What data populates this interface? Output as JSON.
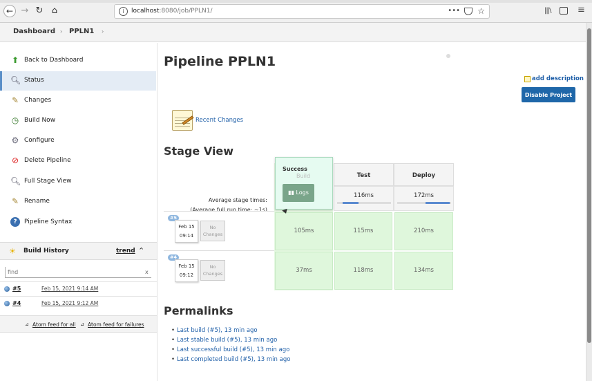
{
  "browser": {
    "url_host": "localhost",
    "url_rest": ":8080/job/PPLN1/",
    "menu_dots": "•••"
  },
  "breadcrumb": {
    "items": [
      "Dashboard",
      "PPLN1"
    ],
    "sep": "›"
  },
  "sidebar": {
    "tasks": [
      {
        "label": "Back to Dashboard",
        "icon": "up-arrow-icon"
      },
      {
        "label": "Status",
        "icon": "magnifier-icon"
      },
      {
        "label": "Changes",
        "icon": "notepad-icon"
      },
      {
        "label": "Build Now",
        "icon": "clock-play-icon"
      },
      {
        "label": "Configure",
        "icon": "gear-icon"
      },
      {
        "label": "Delete Pipeline",
        "icon": "no-entry-icon"
      },
      {
        "label": "Full Stage View",
        "icon": "magnifier-icon"
      },
      {
        "label": "Rename",
        "icon": "notepad-icon"
      },
      {
        "label": "Pipeline Syntax",
        "icon": "help-icon"
      }
    ],
    "build_history": {
      "title": "Build History",
      "trend": "trend",
      "find_placeholder": "find",
      "find_clear": "x",
      "builds": [
        {
          "num": "#5",
          "date": "Feb 15, 2021 9:14 AM"
        },
        {
          "num": "#4",
          "date": "Feb 15, 2021 9:12 AM"
        }
      ],
      "feed_all": "Atom feed for all",
      "feed_failures": "Atom feed for failures"
    }
  },
  "main": {
    "title": "Pipeline PPLN1",
    "add_description": "add description",
    "disable_button": "Disable Project",
    "recent_changes": "Recent Changes",
    "stage_view_title": "Stage View",
    "avg_label_line1": "Average stage times:",
    "avg_label_line2_pre": "(Average ",
    "avg_label_line2_u": "full",
    "avg_label_line2_post": " run time: ~1s)",
    "stages": [
      "Build",
      "Test",
      "Deploy"
    ],
    "stage_avg": [
      "",
      "116ms",
      "172ms"
    ],
    "stage_avg_fraction": [
      0.3,
      0.3,
      0.45
    ],
    "runs": [
      {
        "badge": "#5",
        "date": "Feb 15",
        "time": "09:14",
        "no_changes": [
          "No",
          "Changes"
        ],
        "times": [
          "105ms",
          "115ms",
          "210ms"
        ]
      },
      {
        "badge": "#4",
        "date": "Feb 15",
        "time": "09:12",
        "no_changes": [
          "No",
          "Changes"
        ],
        "times": [
          "37ms",
          "118ms",
          "134ms"
        ]
      }
    ],
    "popup": {
      "title": "Success",
      "sub": "Build",
      "logs": "Logs"
    },
    "permalinks_title": "Permalinks",
    "permalinks": [
      "Last build (#5), 13 min ago",
      "Last stable build (#5), 13 min ago",
      "Last successful build (#5), 13 min ago",
      "Last completed build (#5), 13 min ago"
    ]
  }
}
